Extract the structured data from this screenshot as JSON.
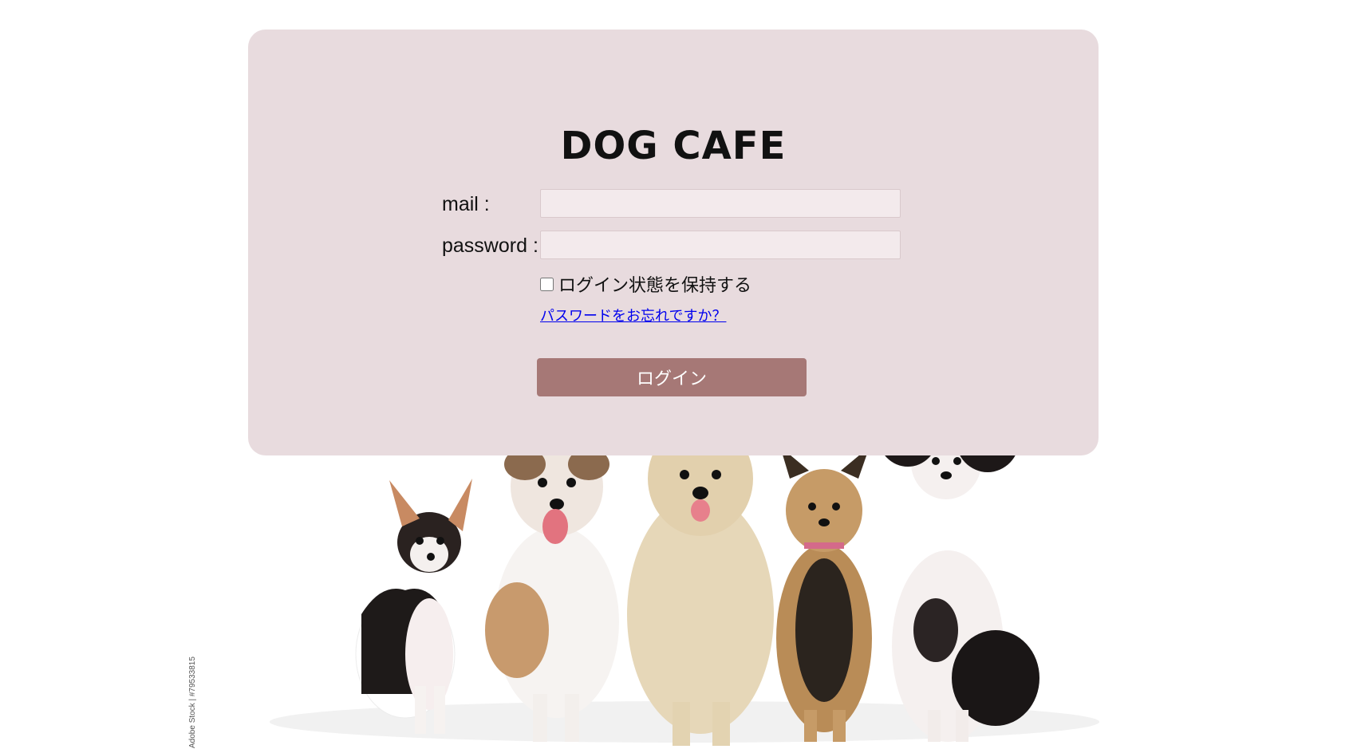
{
  "app": {
    "title": "DOG CAFE"
  },
  "login": {
    "mail_label": "mail :",
    "mail_value": "",
    "password_label": "password :",
    "password_value": "",
    "remember_label": "ログイン状態を保持する",
    "remember_checked": false,
    "forgot_link": "パスワードをお忘れですか？",
    "submit_label": "ログイン"
  },
  "background": {
    "image": "five-dogs-sitting-photo",
    "credit": "Adobe Stock | #79533815"
  },
  "colors": {
    "card_bg": "#e8dbde",
    "input_bg": "#f3eaec",
    "button_bg": "#a67876",
    "link": "#0000ee"
  }
}
